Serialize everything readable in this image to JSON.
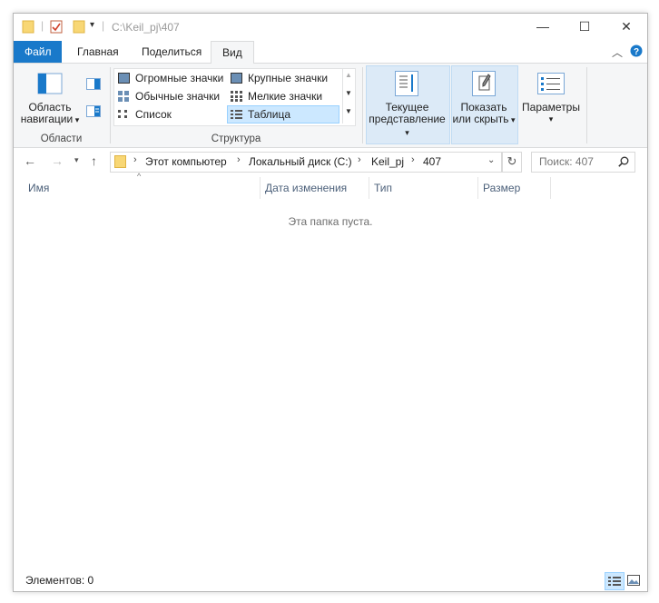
{
  "title_bar": {
    "path": "C:\\Keil_pj\\407",
    "minimize": "—",
    "maximize": "☐",
    "close": "✕"
  },
  "tabs": [
    {
      "label": "Файл"
    },
    {
      "label": "Главная"
    },
    {
      "label": "Поделиться"
    },
    {
      "label": "Вид"
    }
  ],
  "ribbon": {
    "panes": {
      "nav_pane_label_1": "Область",
      "nav_pane_label_2": "навигации",
      "group_label": "Области"
    },
    "layout": {
      "items": [
        {
          "label": "Огромные значки"
        },
        {
          "label": "Крупные значки"
        },
        {
          "label": "Обычные значки"
        },
        {
          "label": "Мелкие значки"
        },
        {
          "label": "Список"
        },
        {
          "label": "Таблица"
        }
      ],
      "group_label": "Структура"
    },
    "current_view": {
      "label_1": "Текущее",
      "label_2": "представление"
    },
    "show_hide": {
      "label_1": "Показать",
      "label_2": "или скрыть"
    },
    "options": {
      "label": "Параметры"
    }
  },
  "address": {
    "crumbs": [
      "Этот компьютер",
      "Локальный диск (C:)",
      "Keil_pj",
      "407"
    ]
  },
  "search": {
    "placeholder": "Поиск: 407"
  },
  "columns": [
    {
      "label": "Имя"
    },
    {
      "label": "Дата изменения"
    },
    {
      "label": "Тип"
    },
    {
      "label": "Размер"
    }
  ],
  "empty_message": "Эта папка пуста.",
  "status": {
    "items_text": "Элементов: 0"
  },
  "colors": {
    "accent": "#1979ca",
    "selection": "#cce8ff"
  }
}
